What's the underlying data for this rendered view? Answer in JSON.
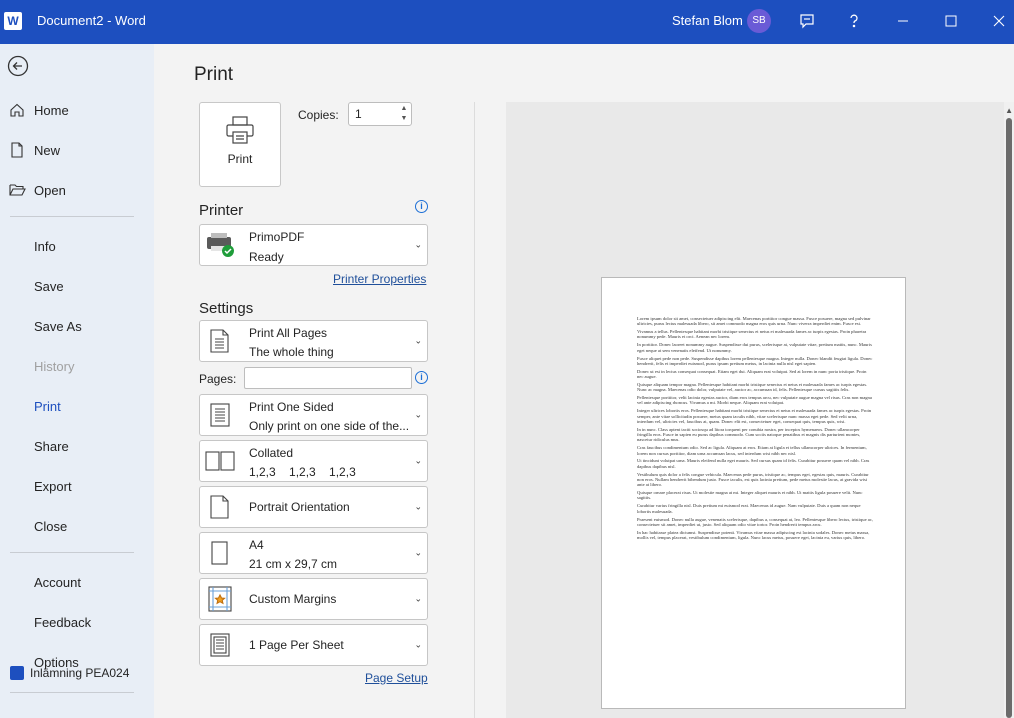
{
  "titlebar": {
    "logo_letter": "W",
    "title": "Document2 - Word",
    "user_name": "Stefan Blom",
    "user_initials": "SB"
  },
  "nav": {
    "items": [
      {
        "label": "Home"
      },
      {
        "label": "New"
      },
      {
        "label": "Open"
      },
      {
        "label": "Info"
      },
      {
        "label": "Save"
      },
      {
        "label": "Save As"
      },
      {
        "label": "History"
      },
      {
        "label": "Print"
      },
      {
        "label": "Share"
      },
      {
        "label": "Export"
      },
      {
        "label": "Close"
      },
      {
        "label": "Account"
      },
      {
        "label": "Feedback"
      },
      {
        "label": "Options"
      }
    ],
    "recent_doc": "Inlämning PEA024"
  },
  "print": {
    "title": "Print",
    "print_button": "Print",
    "copies_label": "Copies:",
    "copies_value": "1",
    "printer_heading": "Printer",
    "printer_name": "PrimoPDF",
    "printer_status": "Ready",
    "printer_properties": "Printer Properties",
    "settings_heading": "Settings",
    "pages_label": "Pages:",
    "pages_value": "",
    "settings": [
      {
        "line1": "Print All Pages",
        "line2": "The whole thing"
      },
      {
        "line1": "Print One Sided",
        "line2": "Only print on one side of the..."
      },
      {
        "line1": "Collated",
        "line2": "1,2,3    1,2,3    1,2,3"
      },
      {
        "line1": "Portrait Orientation",
        "line2": ""
      },
      {
        "line1": "A4",
        "line2": "21 cm x 29,7 cm"
      },
      {
        "line1": "Custom Margins",
        "line2": ""
      },
      {
        "line1": "1 Page Per Sheet",
        "line2": ""
      }
    ],
    "page_setup": "Page Setup"
  },
  "preview": {
    "paragraphs": [
      "Lorem ipsum dolor sit amet, consectetuer adipiscing elit. Maecenas porttitor congue massa. Fusce posuere, magna sed pulvinar ultricies, purus lectus malesuada libero, sit amet commodo magna eros quis urna. Nunc viverra imperdiet enim. Fusce est.",
      "Vivamus a tellus. Pellentesque habitant morbi tristique senectus et netus et malesuada fames ac turpis egestas. Proin pharetra nonummy pede. Mauris et orci. Aenean nec lorem.",
      "In porttitor. Donec laoreet nonummy augue. Suspendisse dui purus, scelerisque at, vulputate vitae, pretium mattis, nunc. Mauris eget neque at sem venenatis eleifend. Ut nonummy.",
      "Fusce aliquet pede non pede. Suspendisse dapibus lorem pellentesque magna. Integer nulla. Donec blandit feugiat ligula. Donec hendrerit, felis et imperdiet euismod, purus ipsum pretium metus, in lacinia nulla nisl eget sapien.",
      "Donec ut est in lectus consequat consequat. Etiam eget dui. Aliquam erat volutpat. Sed at lorem in nunc porta tristique. Proin nec augue.",
      "Quisque aliquam tempor magna. Pellentesque habitant morbi tristique senectus et netus et malesuada fames ac turpis egestas. Nunc ac magna. Maecenas odio dolor, vulputate vel, auctor ac, accumsan id, felis. Pellentesque cursus sagittis felis.",
      "Pellentesque porttitor, velit lacinia egestas auctor, diam eros tempus arcu, nec vulputate augue magna vel risus. Cras non magna vel ante adipiscing rhoncus. Vivamus a mi. Morbi neque. Aliquam erat volutpat.",
      "Integer ultrices lobortis eros. Pellentesque habitant morbi tristique senectus et netus et malesuada fames ac turpis egestas. Proin semper, ante vitae sollicitudin posuere, metus quam iaculis nibh, vitae scelerisque nunc massa eget pede. Sed velit urna, interdum vel, ultricies vel, faucibus at, quam. Donec elit est, consectetuer eget, consequat quis, tempus quis, wisi.",
      "In in nunc. Class aptent taciti sociosqu ad litora torquent per conubia nostra, per inceptos hymenaeos. Donec ullamcorper fringilla eros. Fusce in sapien eu purus dapibus commodo. Cum sociis natoque penatibus et magnis dis parturient montes, nascetur ridiculus mus.",
      "Cras faucibus condimentum odio. Sed ac ligula. Aliquam at eros. Etiam at ligula et tellus ullamcorper ultrices. In fermentum, lorem non cursus porttitor, diam urna accumsan lacus, sed interdum wisi nibh nec nisl.",
      "Ut tincidunt volutpat urna. Mauris eleifend nulla eget mauris. Sed cursus quam id felis. Curabitur posuere quam vel nibh. Cras dapibus dapibus nisl.",
      "Vestibulum quis dolor a felis congue vehicula. Maecenas pede purus, tristique ac, tempus eget, egestas quis, mauris. Curabitur non eros. Nullam hendrerit bibendum justo. Fusce iaculis, est quis lacinia pretium, pede metus molestie lacus, at gravida wisi ante at libero.",
      "Quisque ornare placerat risus. Ut molestie magna at mi. Integer aliquet mauris et nibh. Ut mattis ligula posuere velit. Nunc sagittis.",
      "Curabitur varius fringilla nisl. Duis pretium mi euismod erat. Maecenas id augue. Nam vulputate. Duis a quam non neque lobortis malesuada.",
      "Praesent euismod. Donec nulla augue, venenatis scelerisque, dapibus a, consequat at, leo. Pellentesque libero lectus, tristique ac, consectetuer sit amet, imperdiet ut, justo. Sed aliquam odio vitae tortor. Proin hendrerit tempus arcu.",
      "In hac habitasse platea dictumst. Suspendisse potenti. Vivamus vitae massa adipiscing est lacinia sodales. Donec metus massa, mollis vel, tempus placerat, vestibulum condimentum, ligula. Nunc lacus metus, posuere eget, lacinia eu, varius quis, libero."
    ]
  }
}
